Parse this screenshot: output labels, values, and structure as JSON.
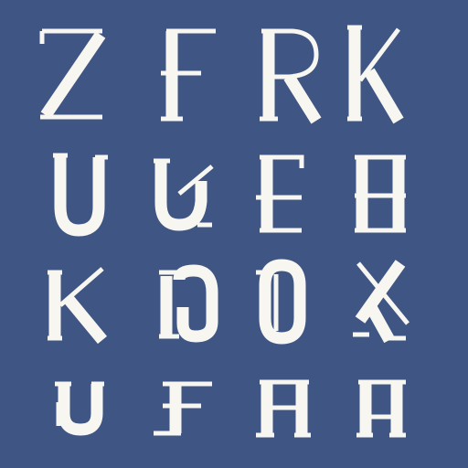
{
  "colors": {
    "background": "#3f5583",
    "glyph": "#f7f6f1"
  },
  "rows": [
    {
      "letters": [
        "Z",
        "E",
        "R",
        "K"
      ]
    },
    {
      "letters": [
        "U",
        "U",
        "E",
        "B"
      ]
    },
    {
      "letters": [
        "K",
        "G",
        "O",
        "X"
      ]
    },
    {
      "letters": [
        "U",
        "F",
        "A",
        "A"
      ]
    }
  ]
}
